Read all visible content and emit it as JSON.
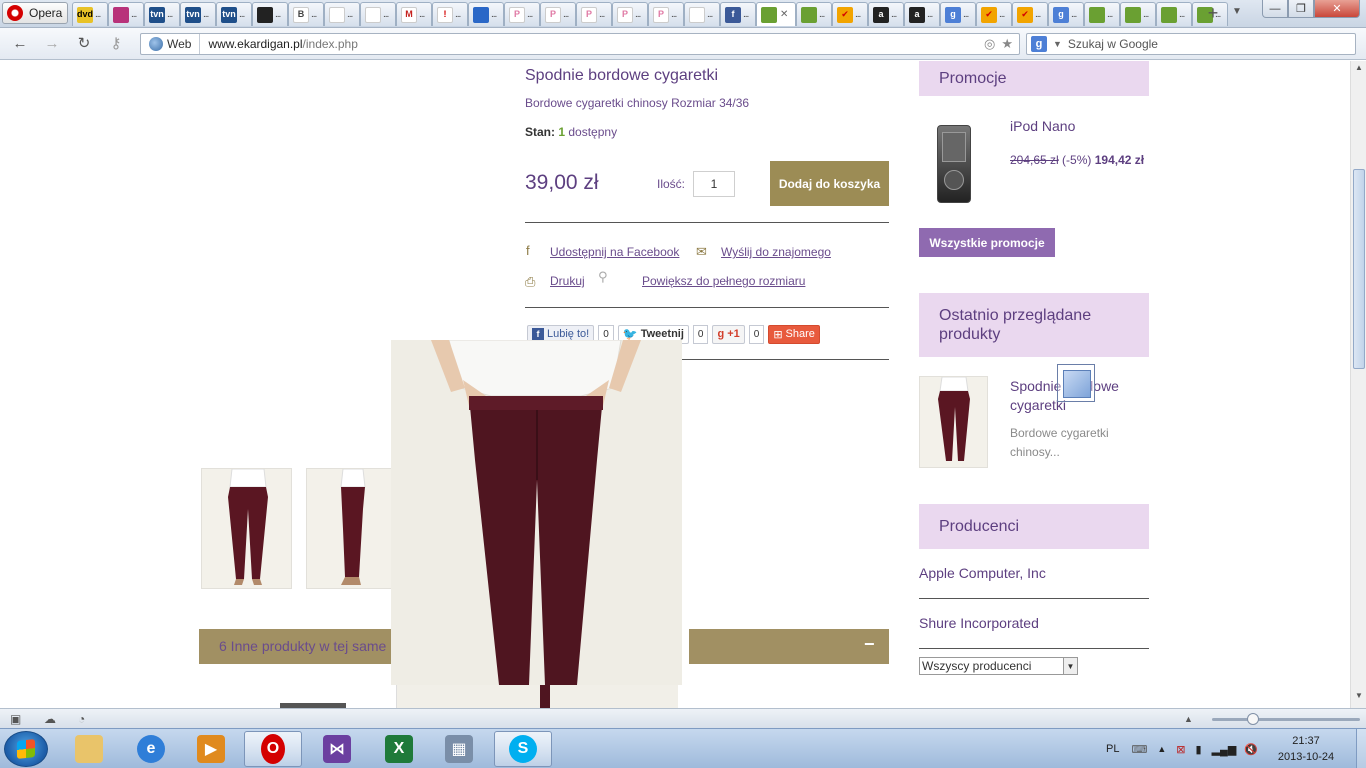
{
  "browser": {
    "menu_label": "Opera",
    "tabs": [
      {
        "icon": "dvd",
        "color": "#e8c227",
        "fg": "#000"
      },
      {
        "icon": "",
        "color": "#b8327a",
        "fg": "#fff"
      },
      {
        "icon": "tvn",
        "color": "#1f4f8a",
        "fg": "#fff"
      },
      {
        "icon": "tvn",
        "color": "#1f4f8a",
        "fg": "#fff"
      },
      {
        "icon": "tvn",
        "color": "#1f4f8a",
        "fg": "#fff"
      },
      {
        "icon": "",
        "color": "#222222",
        "fg": "#fff"
      },
      {
        "icon": "B",
        "color": "#ffffff",
        "fg": "#444"
      },
      {
        "icon": "",
        "color": "#ffffff",
        "fg": "#444"
      },
      {
        "icon": "",
        "color": "#ffffff",
        "fg": "#333"
      },
      {
        "icon": "M",
        "color": "#ffffff",
        "fg": "#c5221f"
      },
      {
        "icon": "!",
        "color": "#ffffff",
        "fg": "#d40000"
      },
      {
        "icon": "",
        "color": "#2a67c7",
        "fg": "#fff"
      },
      {
        "icon": "P",
        "color": "#ffffff",
        "fg": "#e07aa5"
      },
      {
        "icon": "P",
        "color": "#ffffff",
        "fg": "#e07aa5"
      },
      {
        "icon": "P",
        "color": "#ffffff",
        "fg": "#e07aa5"
      },
      {
        "icon": "P",
        "color": "#ffffff",
        "fg": "#e07aa5"
      },
      {
        "icon": "P",
        "color": "#ffffff",
        "fg": "#e07aa5"
      },
      {
        "icon": "",
        "color": "#ffffff",
        "fg": "#444"
      },
      {
        "icon": "f",
        "color": "#3b5998",
        "fg": "#fff"
      }
    ],
    "active_tab": {
      "icon": "",
      "color": "#6aa032",
      "fg": "#fff"
    },
    "tabs_after": [
      {
        "icon": "",
        "color": "#6aa032",
        "fg": "#fff"
      },
      {
        "icon": "✔",
        "color": "#f2a400",
        "fg": "#d40000"
      },
      {
        "icon": "a",
        "color": "#222222",
        "fg": "#fff"
      },
      {
        "icon": "a",
        "color": "#222222",
        "fg": "#fff"
      },
      {
        "icon": "g",
        "color": "#4d7fd6",
        "fg": "#fff"
      },
      {
        "icon": "✔",
        "color": "#f2a400",
        "fg": "#d40000"
      },
      {
        "icon": "✔",
        "color": "#f2a400",
        "fg": "#d40000"
      },
      {
        "icon": "g",
        "color": "#4d7fd6",
        "fg": "#fff"
      },
      {
        "icon": "",
        "color": "#6aa032",
        "fg": "#fff"
      },
      {
        "icon": "",
        "color": "#6aa032",
        "fg": "#fff"
      },
      {
        "icon": "",
        "color": "#6aa032",
        "fg": "#fff"
      },
      {
        "icon": "",
        "color": "#6aa032",
        "fg": "#fff"
      }
    ],
    "tab_dots": "...",
    "addr_web_label": "Web",
    "url_host": "www.ekardigan.pl",
    "url_path": "/index.php",
    "search_placeholder": "Szukaj w Google"
  },
  "product": {
    "title": "Spodnie bordowe cygaretki",
    "description": "Bordowe cygaretki chinosy Rozmiar 34/36",
    "stock_label": "Stan:",
    "stock_count": "1",
    "stock_text": "dostępny",
    "price": "39,00 zł",
    "qty_label": "Ilość:",
    "qty_value": "1",
    "add_to_cart": "Dodaj do koszyka",
    "links": {
      "facebook": "Udostępnij na Facebook",
      "email": "Wyślij do znajomego",
      "print": "Drukuj",
      "zoom": "Powiększ do pełnego rozmiaru"
    },
    "social": {
      "like": "Lubię to!",
      "like_count": "0",
      "tweet": "Tweetnij",
      "tweet_count": "0",
      "gplus": "+1",
      "gplus_count": "0",
      "share": "Share"
    },
    "other_products_bar": "6 Inne produkty w tej same",
    "collapse_symbol": "−"
  },
  "sidebar": {
    "promo_header": "Promocje",
    "promo_item": {
      "name": "iPod Nano",
      "old_price": "204,65 zł",
      "discount": "(-5%)",
      "new_price": "194,42 zł"
    },
    "promo_button": "Wszystkie promocje",
    "recent_header": "Ostatnio przeglądane produkty",
    "recent_item": {
      "name": "Spodnie bordowe cygaretki",
      "desc": "Bordowe cygaretki chinosy..."
    },
    "makers_header": "Producenci",
    "makers": [
      "Apple Computer, Inc",
      "Shure Incorporated"
    ],
    "makers_select": "Wszyscy producenci"
  },
  "taskbar": {
    "lang": "PL",
    "time": "21:37",
    "date": "2013-10-24",
    "apps": [
      {
        "name": "explorer",
        "color": "#e9c46a",
        "glyph": ""
      },
      {
        "name": "ie",
        "color": "#2f7ed8",
        "glyph": "e"
      },
      {
        "name": "media",
        "color": "#e08a1e",
        "glyph": "▶"
      },
      {
        "name": "opera",
        "color": "#d40000",
        "glyph": "O"
      },
      {
        "name": "vs",
        "color": "#6b3fa0",
        "glyph": "⋈"
      },
      {
        "name": "excel",
        "color": "#1f7a3a",
        "glyph": "X"
      },
      {
        "name": "calc",
        "color": "#7a8ea8",
        "glyph": "▦"
      },
      {
        "name": "skype",
        "color": "#00aff0",
        "glyph": "S"
      }
    ]
  }
}
